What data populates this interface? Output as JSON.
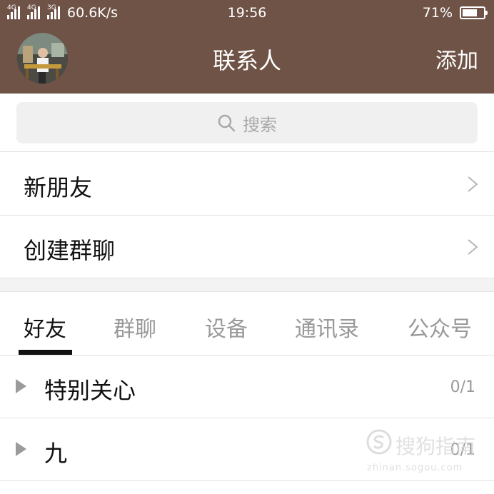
{
  "status_bar": {
    "network_1": "4G",
    "network_2": "4G",
    "network_3": "3G",
    "speed": "60.6K/s",
    "time": "19:56",
    "battery_text": "71%",
    "battery_level": 0.71
  },
  "header": {
    "title": "联系人",
    "add_label": "添加",
    "background": "#6f5347"
  },
  "search": {
    "placeholder": "搜索"
  },
  "menu": {
    "new_friends": "新朋友",
    "create_group": "创建群聊"
  },
  "tabs": [
    {
      "label": "好友",
      "active": true
    },
    {
      "label": "群聊",
      "active": false
    },
    {
      "label": "设备",
      "active": false
    },
    {
      "label": "通讯录",
      "active": false
    },
    {
      "label": "公众号",
      "active": false
    }
  ],
  "groups": [
    {
      "name": "特别关心",
      "count": "0/1"
    },
    {
      "name": "九",
      "count": "0/1"
    }
  ],
  "watermark": {
    "text": "搜狗指南",
    "url": "zhinan.sogou.com"
  }
}
